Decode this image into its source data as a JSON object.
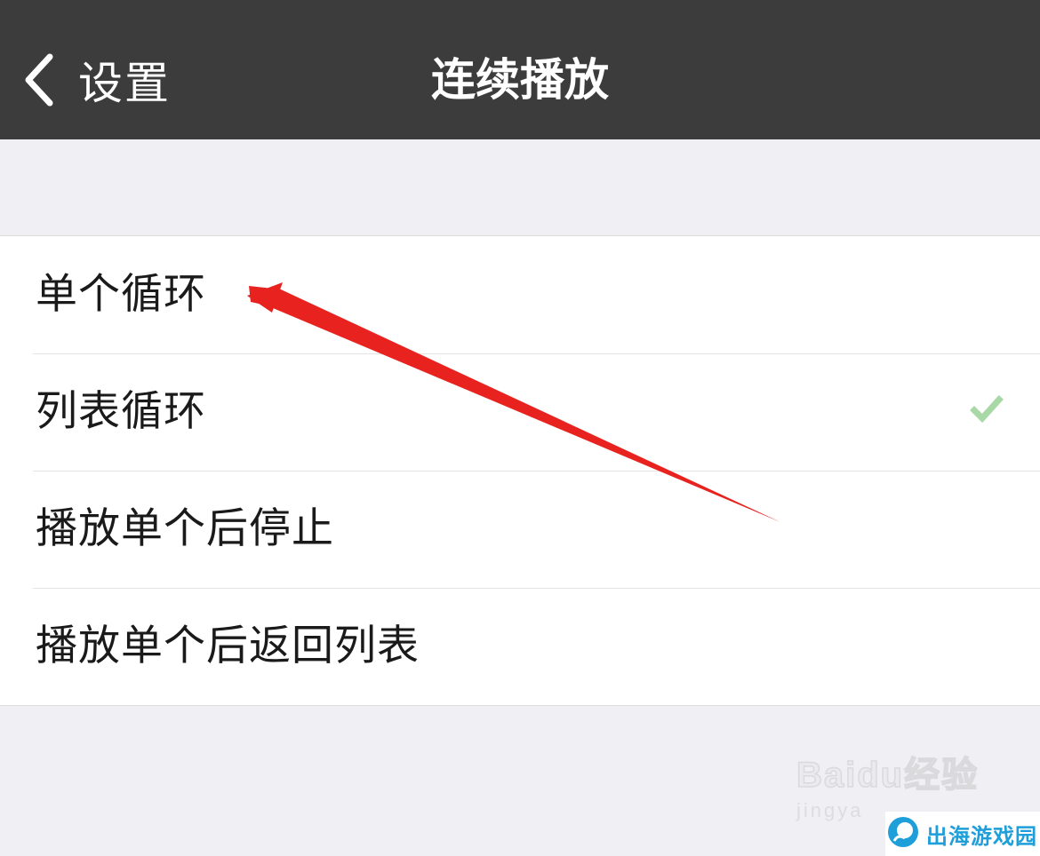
{
  "nav": {
    "back_label": "设置",
    "title": "连续播放"
  },
  "options": [
    {
      "label": "单个循环",
      "selected": false
    },
    {
      "label": "列表循环",
      "selected": true
    },
    {
      "label": "播放单个后停止",
      "selected": false
    },
    {
      "label": "播放单个后返回列表",
      "selected": false
    }
  ],
  "annotation": {
    "arrow_color": "#e8231f"
  },
  "watermark": {
    "logo": "Baidu经验",
    "sub": "jingya"
  },
  "badge": {
    "text": "出海游戏园",
    "color": "#1f9fd9"
  },
  "colors": {
    "nav_bg": "#3c3c3d",
    "page_bg": "#efeff4",
    "check": "#5fb85c"
  }
}
